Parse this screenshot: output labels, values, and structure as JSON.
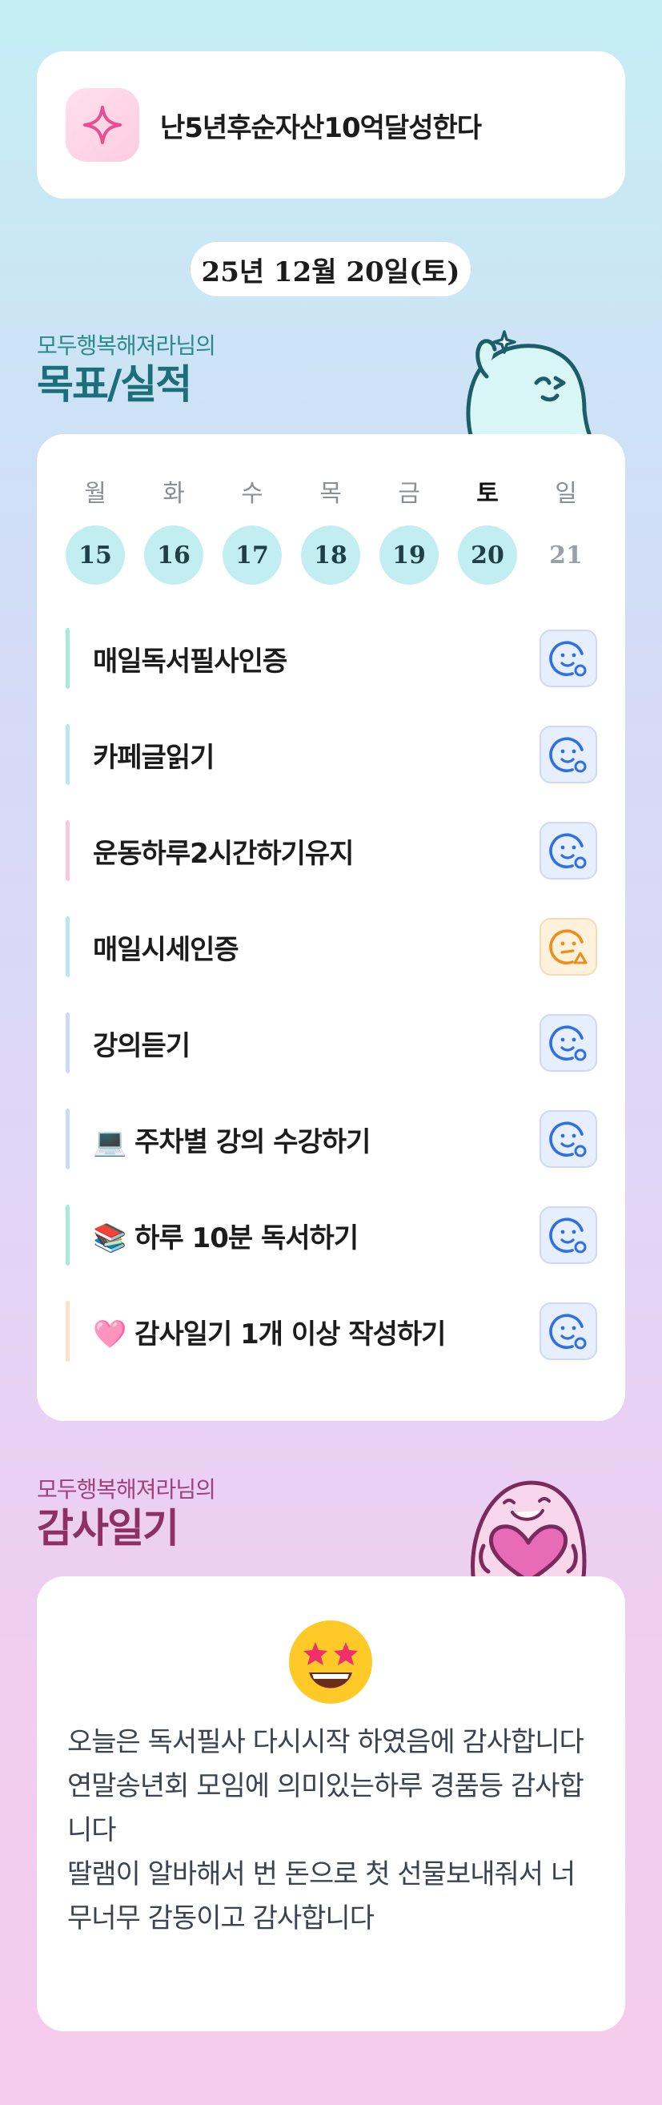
{
  "goal": {
    "text": "난5년후순자산10억달성한다",
    "icon": "sparkle-icon",
    "accent": "#e94e8f"
  },
  "date": "25년 12월 20일(토)",
  "records_section": {
    "owner": "모두행복해져라님의",
    "title": "목표/실적",
    "owner_color": "#2b8a8a",
    "title_color": "#1b6f78"
  },
  "week": [
    {
      "label": "월",
      "day": "15",
      "state": "past"
    },
    {
      "label": "화",
      "day": "16",
      "state": "past"
    },
    {
      "label": "수",
      "day": "17",
      "state": "past"
    },
    {
      "label": "목",
      "day": "18",
      "state": "past"
    },
    {
      "label": "금",
      "day": "19",
      "state": "past"
    },
    {
      "label": "토",
      "day": "20",
      "state": "today"
    },
    {
      "label": "일",
      "day": "21",
      "state": "future"
    }
  ],
  "tasks": [
    {
      "label": "매일독서필사인증",
      "bar_color": "#a6ebd7",
      "status": "ok"
    },
    {
      "label": "카페글읽기",
      "bar_color": "#b7e9ef",
      "status": "ok"
    },
    {
      "label": "운동하루2시간하기유지",
      "bar_color": "#f8c9dc",
      "status": "ok"
    },
    {
      "label": "매일시세인증",
      "bar_color": "#b7e9ef",
      "status": "warn"
    },
    {
      "label": "강의듣기",
      "bar_color": "#cfdaf5",
      "status": "ok"
    },
    {
      "label": "💻 주차별 강의 수강하기",
      "bar_color": "#cfdaf5",
      "status": "ok"
    },
    {
      "label": "📚 하루 10분 독서하기",
      "bar_color": "#a6ebd7",
      "status": "ok"
    },
    {
      "label": "🩷 감사일기 1개 이상 작성하기",
      "bar_color": "#fbe2c0",
      "status": "ok"
    }
  ],
  "status_icons": {
    "ok": "smile-check-icon",
    "warn": "neutral-warning-icon"
  },
  "status_colors": {
    "ok": "#2f6fe4",
    "warn": "#ef8d19"
  },
  "gratitude_section": {
    "owner": "모두행복해져라님의",
    "title": "감사일기",
    "owner_color": "#a04277",
    "title_color": "#8e2f67"
  },
  "gratitude": {
    "emoji": "star-struck-emoji",
    "text": "오늘은 독서필사 다시시작 하였음에 감사합니다\n연말송년회 모임에 의미있는하루 경품등 감사합니다\n딸램이 알바해서 번 돈으로 첫 선물보내줘서 너무너무 감동이고 감사합니다"
  }
}
